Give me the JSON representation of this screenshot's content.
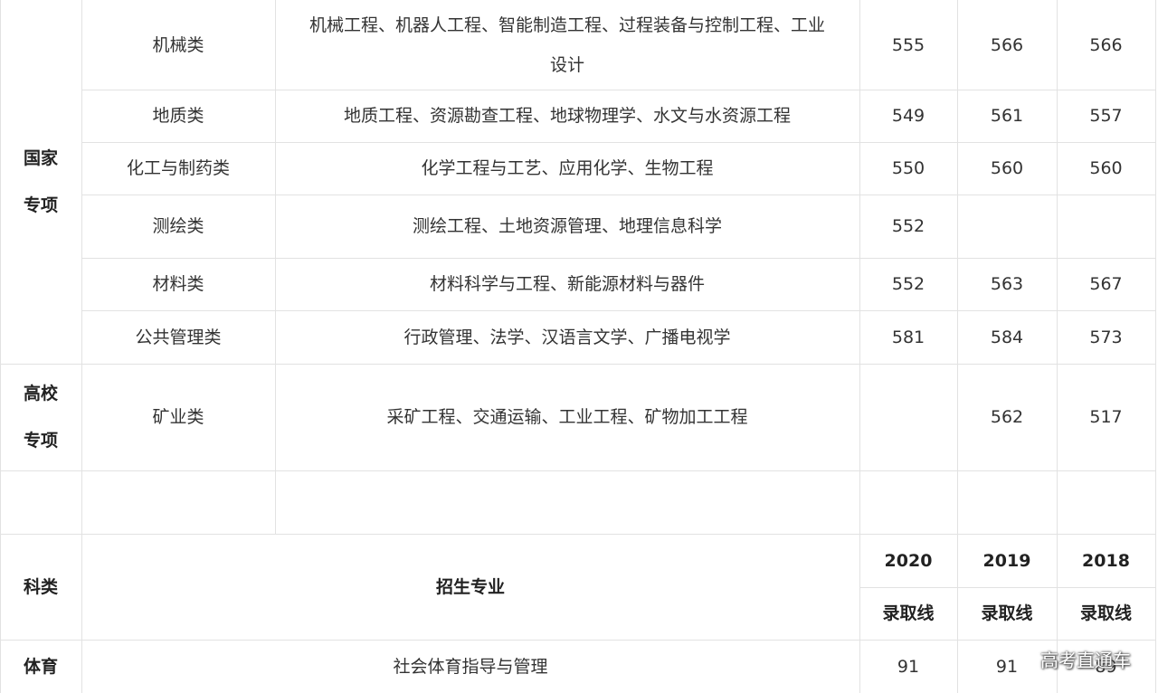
{
  "upper_section": {
    "groups": [
      {
        "label_line1": "国家",
        "label_line2": "专项"
      },
      {
        "label_line1": "高校",
        "label_line2": "专项"
      }
    ],
    "rows": [
      {
        "category": "机械类",
        "majors_line1": "机械工程、机器人工程、智能制造工程、过程装备与控制工程、工业",
        "majors_line2": "设计",
        "y2020": "555",
        "y2019": "566",
        "y2018": "566"
      },
      {
        "category": "地质类",
        "majors": "地质工程、资源勘查工程、地球物理学、水文与水资源工程",
        "y2020": "549",
        "y2019": "561",
        "y2018": "557"
      },
      {
        "category": "化工与制药类",
        "majors": "化学工程与工艺、应用化学、生物工程",
        "y2020": "550",
        "y2019": "560",
        "y2018": "560"
      },
      {
        "category": "测绘类",
        "majors": "测绘工程、土地资源管理、地理信息科学",
        "y2020": "552",
        "y2019": "",
        "y2018": ""
      },
      {
        "category": "材料类",
        "majors": "材料科学与工程、新能源材料与器件",
        "y2020": "552",
        "y2019": "563",
        "y2018": "567"
      },
      {
        "category": "公共管理类",
        "majors": "行政管理、法学、汉语言文学、广播电视学",
        "y2020": "581",
        "y2019": "584",
        "y2018": "573"
      },
      {
        "category": "矿业类",
        "majors": "采矿工程、交通运输、工业工程、矿物加工工程",
        "y2020": "",
        "y2019": "562",
        "y2018": "517"
      }
    ]
  },
  "lower_header": {
    "subject": "科类",
    "majors": "招生专业",
    "years": [
      "2020",
      "2019",
      "2018"
    ],
    "line_label": "录取线"
  },
  "lower_rows": [
    {
      "subject": "体育",
      "majors": "社会体育指导与管理",
      "y2020": "91",
      "y2019": "91",
      "y2018": "89"
    }
  ],
  "watermark": "高考直通车"
}
